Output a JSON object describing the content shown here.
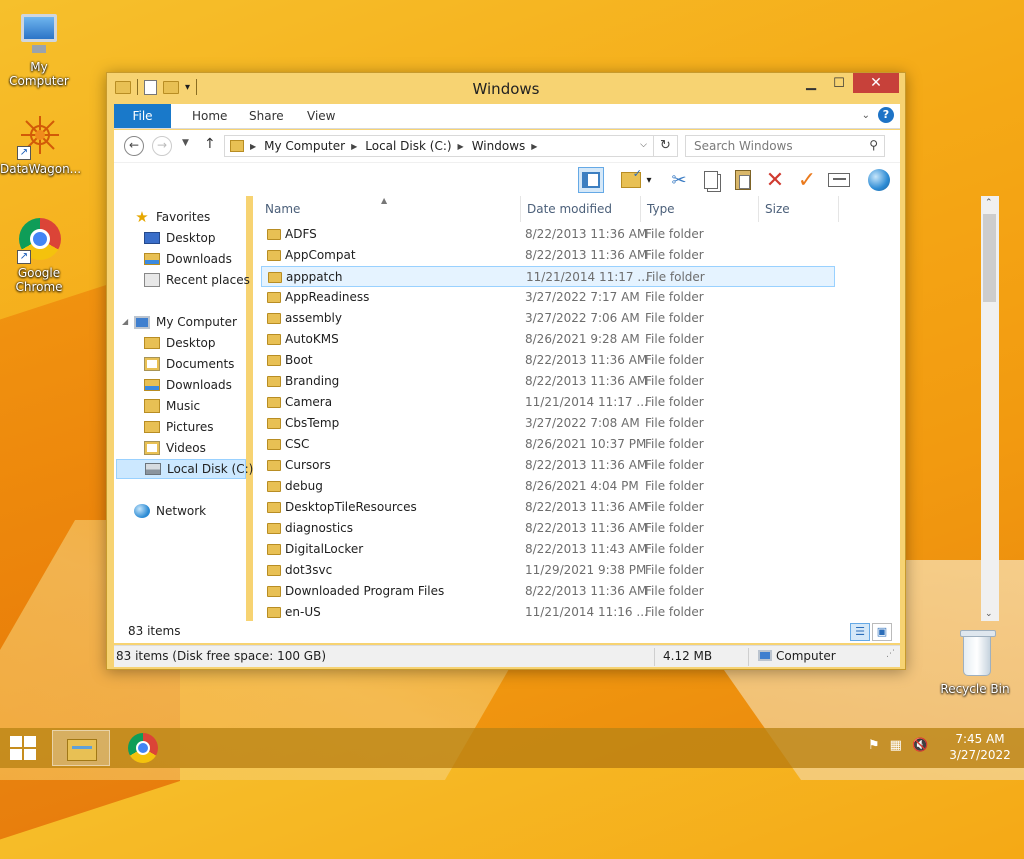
{
  "desktop": {
    "icons": [
      {
        "label": "My Computer"
      },
      {
        "label": "DataWagon..."
      },
      {
        "label": "Google Chrome"
      },
      {
        "label": "Recycle Bin"
      }
    ]
  },
  "window": {
    "title": "Windows",
    "controls": {
      "minimize": "▁",
      "maximize": "☐",
      "close": "✕"
    },
    "ribbon_tabs": [
      "File",
      "Home",
      "Share",
      "View"
    ],
    "help": "?",
    "address": {
      "crumbs": [
        "My Computer",
        "Local Disk (C:)",
        "Windows"
      ],
      "search_placeholder": "Search Windows"
    }
  },
  "nav_pane": {
    "favorites": {
      "label": "Favorites",
      "items": [
        "Desktop",
        "Downloads",
        "Recent places"
      ]
    },
    "computer": {
      "label": "My Computer",
      "items": [
        "Desktop",
        "Documents",
        "Downloads",
        "Music",
        "Pictures",
        "Videos",
        "Local Disk (C:)"
      ]
    },
    "network": {
      "label": "Network"
    }
  },
  "file_list": {
    "columns": [
      "Name",
      "Date modified",
      "Type",
      "Size"
    ],
    "rows": [
      {
        "name": "ADFS",
        "date": "8/22/2013 11:36 AM",
        "type": "File folder"
      },
      {
        "name": "AppCompat",
        "date": "8/22/2013 11:36 AM",
        "type": "File folder"
      },
      {
        "name": "apppatch",
        "date": "11/21/2014 11:17 ...",
        "type": "File folder"
      },
      {
        "name": "AppReadiness",
        "date": "3/27/2022 7:17 AM",
        "type": "File folder"
      },
      {
        "name": "assembly",
        "date": "3/27/2022 7:06 AM",
        "type": "File folder"
      },
      {
        "name": "AutoKMS",
        "date": "8/26/2021 9:28 AM",
        "type": "File folder"
      },
      {
        "name": "Boot",
        "date": "8/22/2013 11:36 AM",
        "type": "File folder"
      },
      {
        "name": "Branding",
        "date": "8/22/2013 11:36 AM",
        "type": "File folder"
      },
      {
        "name": "Camera",
        "date": "11/21/2014 11:17 ...",
        "type": "File folder"
      },
      {
        "name": "CbsTemp",
        "date": "3/27/2022 7:08 AM",
        "type": "File folder"
      },
      {
        "name": "CSC",
        "date": "8/26/2021 10:37 PM",
        "type": "File folder"
      },
      {
        "name": "Cursors",
        "date": "8/22/2013 11:36 AM",
        "type": "File folder"
      },
      {
        "name": "debug",
        "date": "8/26/2021 4:04 PM",
        "type": "File folder"
      },
      {
        "name": "DesktopTileResources",
        "date": "8/22/2013 11:36 AM",
        "type": "File folder"
      },
      {
        "name": "diagnostics",
        "date": "8/22/2013 11:36 AM",
        "type": "File folder"
      },
      {
        "name": "DigitalLocker",
        "date": "8/22/2013 11:43 AM",
        "type": "File folder"
      },
      {
        "name": "dot3svc",
        "date": "11/29/2021 9:38 PM",
        "type": "File folder"
      },
      {
        "name": "Downloaded Program Files",
        "date": "8/22/2013 11:36 AM",
        "type": "File folder"
      },
      {
        "name": "en-US",
        "date": "11/21/2014 11:16 ...",
        "type": "File folder"
      }
    ],
    "selected_row": "apppatch"
  },
  "item_count": "83 items",
  "status_bar": {
    "summary": "83 items (Disk free space: 100 GB)",
    "size": "4.12 MB",
    "location": "Computer"
  },
  "taskbar": {
    "time": "7:45 AM",
    "date": "3/27/2022"
  },
  "colors": {
    "accent": "#1979ca",
    "window_frame": "#f7d372",
    "close_button": "#c7413a",
    "selection": "#cce8ff"
  }
}
